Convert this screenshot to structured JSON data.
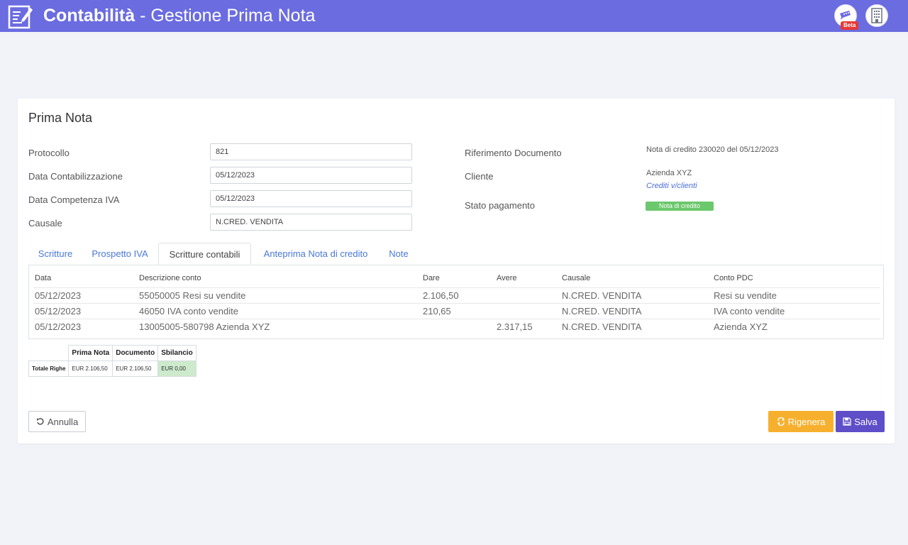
{
  "header": {
    "title_bold": "Contabilità",
    "title_sep": " - ",
    "title_rest": "Gestione Prima Nota",
    "beta_label": "Beta",
    "bg_color": "#6b6ce0"
  },
  "card": {
    "title": "Prima Nota"
  },
  "form": {
    "protocollo_label": "Protocollo",
    "protocollo_value": "821",
    "data_contab_label": "Data Contabilizzazione",
    "data_contab_value": "05/12/2023",
    "data_iva_label": "Data Competenza IVA",
    "data_iva_value": "05/12/2023",
    "causale_label": "Causale",
    "causale_value": "N.CRED. VENDITA"
  },
  "info": {
    "rif_label": "Riferimento Documento",
    "rif_value": "Nota di credito 230020 del 05/12/2023",
    "cliente_label": "Cliente",
    "cliente_name": "Azienda XYZ",
    "cliente_account": "Crediti v/clienti",
    "stato_label": "Stato pagamento",
    "stato_value": "Nota di credito",
    "stato_color": "#6cc86c"
  },
  "tabs": [
    {
      "label": "Scritture"
    },
    {
      "label": "Prospetto IVA"
    },
    {
      "label": "Scritture contabili"
    },
    {
      "label": "Anteprima Nota di credito"
    },
    {
      "label": "Note"
    }
  ],
  "table": {
    "headers": [
      "Data",
      "Descrizione conto",
      "Dare",
      "Avere",
      "Causale",
      "Conto PDC"
    ],
    "rows": [
      [
        "05/12/2023",
        "55050005 Resi su vendite",
        "2.106,50",
        "",
        "N.CRED. VENDITA",
        "Resi su vendite"
      ],
      [
        "05/12/2023",
        "46050 IVA conto vendite",
        "210,65",
        "",
        "N.CRED. VENDITA",
        "IVA conto vendite"
      ],
      [
        "05/12/2023",
        "13005005-580798 Azienda XYZ",
        "",
        "2.317,15",
        "N.CRED. VENDITA",
        "Azienda XYZ"
      ]
    ]
  },
  "totals": {
    "headers": [
      "Prima Nota",
      "Documento",
      "Sbilancio"
    ],
    "row_label": "Totale Righe",
    "values": [
      "EUR 2.106,50",
      "EUR 2.106,50",
      "EUR 0,00"
    ]
  },
  "buttons": {
    "cancel": "Annulla",
    "regen": "Rigenera",
    "save": "Salva"
  }
}
